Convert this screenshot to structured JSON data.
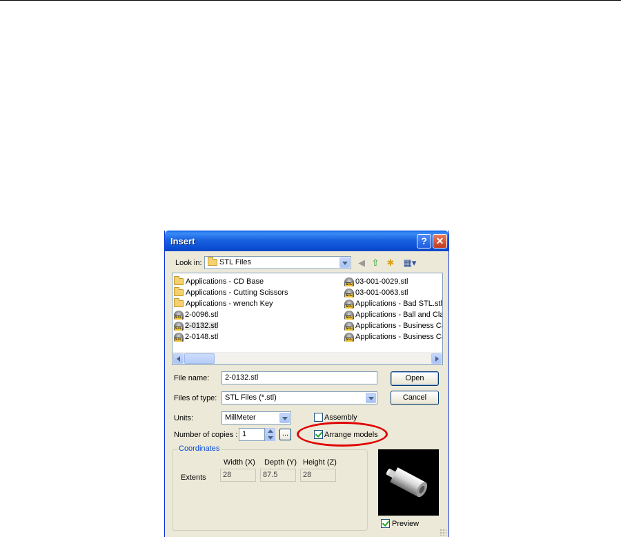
{
  "dialog": {
    "title": "Insert",
    "help_glyph": "?",
    "close_glyph": "✕"
  },
  "look_in": {
    "label": "Look in:",
    "value": "STL Files"
  },
  "toolbar": {
    "back_glyph": "◀",
    "up_glyph": "⇧",
    "new_folder_glyph": "✱",
    "views_glyph": "▦▾"
  },
  "files": {
    "left": [
      {
        "name": "Applications - CD Base",
        "type": "folder"
      },
      {
        "name": "Applications - Cutting Scissors",
        "type": "folder"
      },
      {
        "name": "Applications - wrench Key",
        "type": "folder"
      },
      {
        "name": "2-0096.stl",
        "type": "stl"
      },
      {
        "name": "2-0132.stl",
        "type": "stl"
      },
      {
        "name": "2-0148.stl",
        "type": "stl"
      }
    ],
    "right": [
      {
        "name": "03-001-0029.stl",
        "type": "stl"
      },
      {
        "name": "03-001-0063.stl",
        "type": "stl"
      },
      {
        "name": "Applications - Bad STL.stl",
        "type": "stl"
      },
      {
        "name": "Applications - Ball and Claw",
        "type": "stl"
      },
      {
        "name": "Applications - Business Card",
        "type": "stl"
      },
      {
        "name": "Applications - Business Card",
        "type": "stl"
      }
    ],
    "selected": "2-0132.stl"
  },
  "file_name": {
    "label": "File name:",
    "value": "2-0132.stl"
  },
  "files_of_type": {
    "label": "Files of type:",
    "value": "STL Files (*.stl)"
  },
  "buttons": {
    "open": "Open",
    "cancel": "Cancel",
    "ellipsis": "..."
  },
  "units": {
    "label": "Units:",
    "value": "MillMeter"
  },
  "copies": {
    "label": "Number of copies :",
    "value": "1"
  },
  "assembly": {
    "label": "Assembly",
    "checked": false
  },
  "arrange": {
    "label": "Arrange models",
    "checked": true
  },
  "coordinates": {
    "legend": "Coordinates",
    "row_label": "Extents",
    "headers": [
      "Width (X)",
      "Depth (Y)",
      "Height (Z)"
    ],
    "values": [
      "28",
      "87.5",
      "28"
    ]
  },
  "preview": {
    "label": "Preview",
    "checked": true
  },
  "colors": {
    "titlebar": "#0b4fd6",
    "dialog_bg": "#ece9d8",
    "highlight_ellipse": "#e00000",
    "group_legend": "#0046d5"
  }
}
